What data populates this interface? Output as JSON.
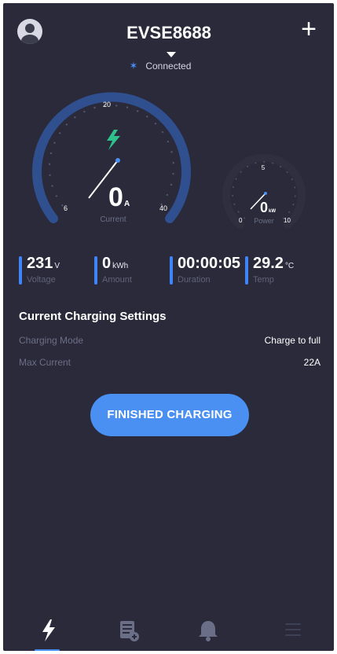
{
  "header": {
    "device_name": "EVSE8688",
    "status_text": "Connected"
  },
  "gauges": {
    "current": {
      "value": "0",
      "unit": "A",
      "label": "Current",
      "min_tick": "6",
      "mid_tick": "20",
      "max_tick": "40"
    },
    "power": {
      "value": "0",
      "unit": "kW",
      "label": "Power",
      "min_tick": "0",
      "mid_tick": "5",
      "max_tick": "10"
    }
  },
  "stats": [
    {
      "value": "231",
      "unit": "V",
      "label": "Voltage"
    },
    {
      "value": "0",
      "unit": "kWh",
      "label": "Amount"
    },
    {
      "value": "00:00:05",
      "unit": "",
      "label": "Duration"
    },
    {
      "value": "29.2",
      "unit": "°C",
      "label": "Temp"
    }
  ],
  "settings": {
    "title": "Current Charging Settings",
    "rows": [
      {
        "key": "Charging Mode",
        "value": "Charge to full"
      },
      {
        "key": "Max Current",
        "value": "22A"
      }
    ]
  },
  "actions": {
    "finished_charging": "FINISHED CHARGING"
  },
  "nav": {
    "items": [
      {
        "name": "charging",
        "icon": "bolt-icon"
      },
      {
        "name": "records",
        "icon": "records-icon"
      },
      {
        "name": "notifications",
        "icon": "bell-icon"
      },
      {
        "name": "menu",
        "icon": "menu-icon"
      }
    ],
    "active_index": 0
  },
  "colors": {
    "background": "#2a2a3a",
    "accent": "#4a8ff2",
    "gauge_arc": "#2f4f8f",
    "bolt_green": "#2fc18c"
  }
}
